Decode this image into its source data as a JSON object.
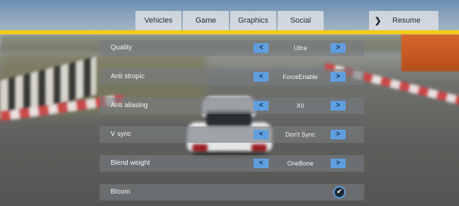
{
  "tabs": [
    {
      "label": "Vehicles"
    },
    {
      "label": "Game"
    },
    {
      "label": "Graphics"
    },
    {
      "label": "Social"
    }
  ],
  "resume": {
    "chevron": "❯",
    "label": "Resume"
  },
  "settings": [
    {
      "label": "Quality",
      "value": "Ultra",
      "prev": "<",
      "next": ">"
    },
    {
      "label": "Anti stropic",
      "value": "ForceEnable",
      "prev": "<",
      "next": ">"
    },
    {
      "label": "Anti aliasing",
      "value": "X0",
      "prev": "<",
      "next": ">"
    },
    {
      "label": "V sync",
      "value": "Don't Sync",
      "prev": "<",
      "next": ">"
    },
    {
      "label": "Blend weight",
      "value": "OneBone",
      "prev": "<",
      "next": ">"
    },
    {
      "label": "Bloom",
      "checked": true,
      "check_glyph": "✔"
    }
  ],
  "colors": {
    "accent_line": "#f1cc1d",
    "button": "#5f9fe0"
  }
}
